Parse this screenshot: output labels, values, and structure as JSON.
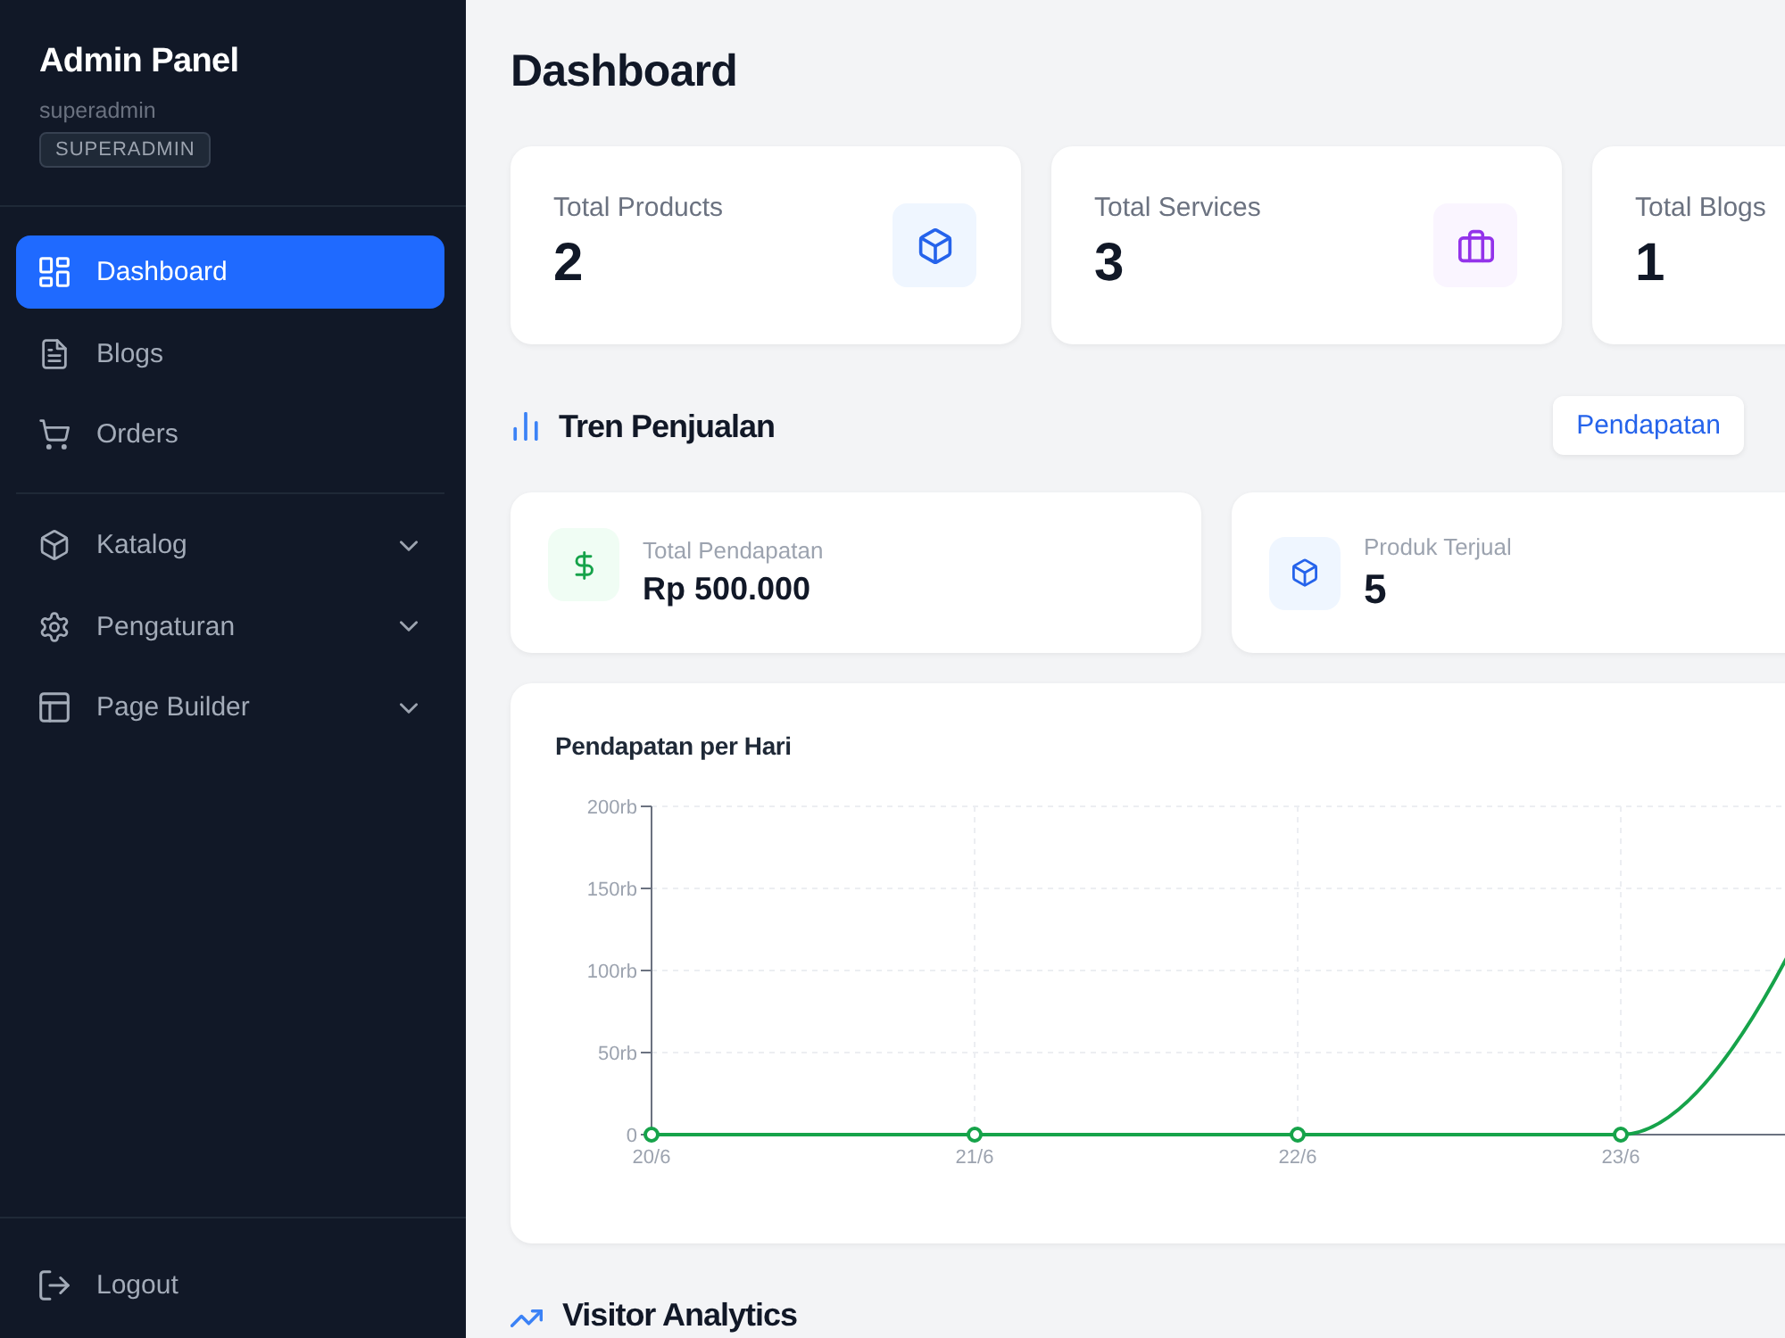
{
  "sidebar": {
    "title": "Admin Panel",
    "username": "superadmin",
    "role_badge": "SUPERADMIN",
    "items": [
      {
        "label": "Dashboard",
        "selected": true
      },
      {
        "label": "Blogs",
        "selected": false
      },
      {
        "label": "Orders",
        "selected": false
      }
    ],
    "groups": [
      {
        "label": "Katalog",
        "expanded": false
      },
      {
        "label": "Pengaturan",
        "expanded": false
      },
      {
        "label": "Page Builder",
        "expanded": false
      }
    ],
    "logout": "Logout"
  },
  "main": {
    "title": "Dashboard",
    "stat_cards": [
      {
        "label": "Total Products",
        "value": "2"
      },
      {
        "label": "Total Services",
        "value": "3"
      },
      {
        "label": "Total Blogs",
        "value": "1"
      }
    ],
    "sales_trend": {
      "title": "Tren Penjualan",
      "tabs": [
        {
          "label": "Pendapatan",
          "selected": true
        }
      ],
      "summary": [
        {
          "label": "Total Pendapatan",
          "value": "Rp 500.000"
        },
        {
          "label": "Produk Terjual",
          "value": "5"
        }
      ],
      "chart_card": {
        "chart_data": {
          "type": "line",
          "title": "Pendapatan per Hari",
          "grid": true,
          "categories": [
            "20/6",
            "21/6",
            "22/6",
            "23/6"
          ],
          "series": [
            {
              "color": "#16a34a",
              "marker": true,
              "values": [
                0,
                0,
                0,
                0
              ]
            }
          ],
          "ylim": [
            0,
            200
          ],
          "yticks": [
            {
              "value": 0,
              "label": "0"
            },
            {
              "value": 50,
              "label": "50rb"
            },
            {
              "value": 100,
              "label": "100rb"
            },
            {
              "value": 150,
              "label": "150rb"
            },
            {
              "value": 200,
              "label": "200rb"
            }
          ]
        }
      }
    },
    "visitor_analytics": {
      "title": "Visitor Analytics"
    }
  }
}
